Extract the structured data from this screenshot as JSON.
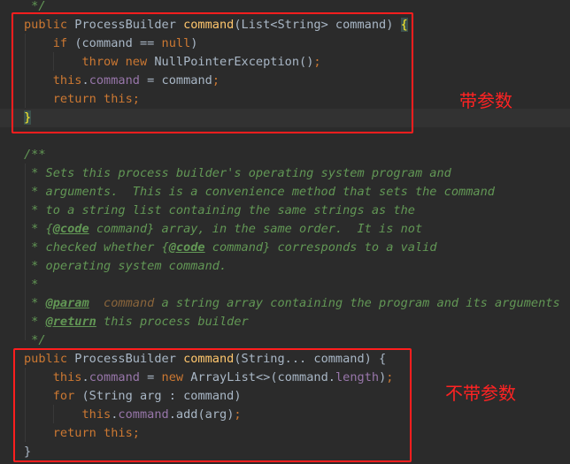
{
  "annotations": {
    "with_params": "带参数",
    "without_params": "不带参数"
  },
  "colors": {
    "background": "#2b2b2b",
    "keyword": "#cc7832",
    "method": "#ffc66d",
    "plain": "#a9b7c6",
    "field": "#9876aa",
    "doc_comment": "#629755",
    "annotation_box": "#ff1e1e"
  },
  "code_lines": [
    [
      {
        "t": "cm",
        "v": " */"
      }
    ],
    [
      {
        "t": "kw",
        "v": "public "
      },
      {
        "t": "pl",
        "v": "ProcessBuilder "
      },
      {
        "t": "fn",
        "v": "command"
      },
      {
        "t": "pl",
        "v": "(List<String> command) "
      },
      {
        "t": "brhl",
        "v": "{"
      }
    ],
    [
      {
        "t": "pl",
        "v": "    "
      },
      {
        "t": "kw",
        "v": "if "
      },
      {
        "t": "pl",
        "v": "(command == "
      },
      {
        "t": "kw",
        "v": "null"
      },
      {
        "t": "pl",
        "v": ")"
      }
    ],
    [
      {
        "t": "pl",
        "v": "        "
      },
      {
        "t": "kw",
        "v": "throw new "
      },
      {
        "t": "pl",
        "v": "NullPointerException()"
      },
      {
        "t": "kw",
        "v": ";"
      }
    ],
    [
      {
        "t": "pl",
        "v": "    "
      },
      {
        "t": "kw",
        "v": "this"
      },
      {
        "t": "pl",
        "v": "."
      },
      {
        "t": "fld",
        "v": "command"
      },
      {
        "t": "pl",
        "v": " = command"
      },
      {
        "t": "kw",
        "v": ";"
      }
    ],
    [
      {
        "t": "pl",
        "v": "    "
      },
      {
        "t": "kw",
        "v": "return this;"
      }
    ],
    [
      {
        "t": "brhl",
        "v": "}"
      }
    ],
    [],
    [
      {
        "t": "cm",
        "v": "/**"
      }
    ],
    [
      {
        "t": "cm",
        "v": " * Sets this process builder's operating system program and"
      }
    ],
    [
      {
        "t": "cm",
        "v": " * arguments.  This is a convenience method that sets the command"
      }
    ],
    [
      {
        "t": "cm",
        "v": " * to a string list containing the same strings as the"
      }
    ],
    [
      {
        "t": "cm",
        "v": " * {"
      },
      {
        "t": "tag",
        "v": "@code"
      },
      {
        "t": "cm",
        "v": " command} array, in the same order.  It is not"
      }
    ],
    [
      {
        "t": "cm",
        "v": " * checked whether {"
      },
      {
        "t": "tag",
        "v": "@code"
      },
      {
        "t": "cm",
        "v": " command} corresponds to a valid"
      }
    ],
    [
      {
        "t": "cm",
        "v": " * operating system command."
      }
    ],
    [
      {
        "t": "cm",
        "v": " *"
      }
    ],
    [
      {
        "t": "cm",
        "v": " * "
      },
      {
        "t": "tag",
        "v": "@param"
      },
      {
        "t": "cm",
        "v": "  "
      },
      {
        "t": "par",
        "v": "command"
      },
      {
        "t": "cm",
        "v": " a string array containing the program and its arguments"
      }
    ],
    [
      {
        "t": "cm",
        "v": " * "
      },
      {
        "t": "tag",
        "v": "@return"
      },
      {
        "t": "cm",
        "v": " this process builder"
      }
    ],
    [
      {
        "t": "cm",
        "v": " */"
      }
    ],
    [
      {
        "t": "kw",
        "v": "public "
      },
      {
        "t": "pl",
        "v": "ProcessBuilder "
      },
      {
        "t": "fn",
        "v": "command"
      },
      {
        "t": "pl",
        "v": "(String... command) {"
      }
    ],
    [
      {
        "t": "pl",
        "v": "    "
      },
      {
        "t": "kw",
        "v": "this"
      },
      {
        "t": "pl",
        "v": "."
      },
      {
        "t": "fld",
        "v": "command"
      },
      {
        "t": "pl",
        "v": " = "
      },
      {
        "t": "kw",
        "v": "new "
      },
      {
        "t": "pl",
        "v": "ArrayList<>(command."
      },
      {
        "t": "fld",
        "v": "length"
      },
      {
        "t": "pl",
        "v": ")"
      },
      {
        "t": "kw",
        "v": ";"
      }
    ],
    [
      {
        "t": "pl",
        "v": "    "
      },
      {
        "t": "kw",
        "v": "for "
      },
      {
        "t": "pl",
        "v": "(String arg : command)"
      }
    ],
    [
      {
        "t": "pl",
        "v": "        "
      },
      {
        "t": "kw",
        "v": "this"
      },
      {
        "t": "pl",
        "v": "."
      },
      {
        "t": "fld",
        "v": "command"
      },
      {
        "t": "pl",
        "v": ".add(arg)"
      },
      {
        "t": "kw",
        "v": ";"
      }
    ],
    [
      {
        "t": "pl",
        "v": "    "
      },
      {
        "t": "kw",
        "v": "return this;"
      }
    ],
    [
      {
        "t": "pl",
        "v": "}"
      }
    ]
  ]
}
